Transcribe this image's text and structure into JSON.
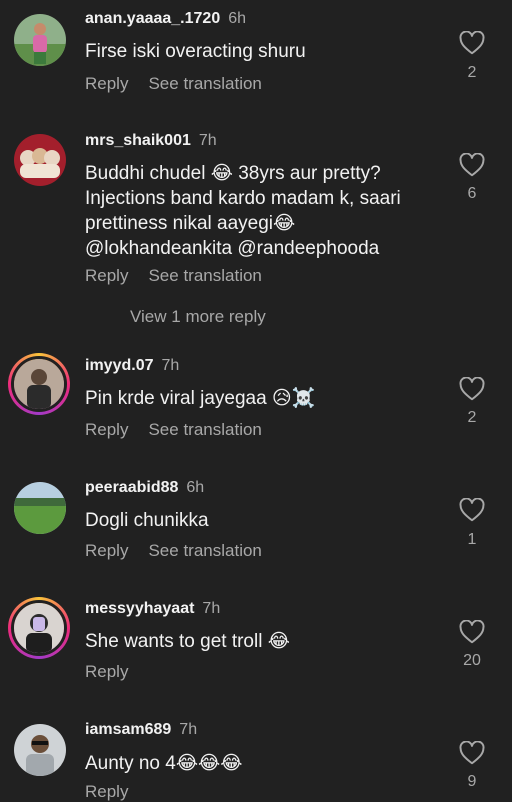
{
  "comments": [
    {
      "username": "anan.yaaaa_.1720",
      "time": "6h",
      "text": "Firse iski overacting shuru",
      "reply_label": "Reply",
      "translation_label": "See translation",
      "likes": "2",
      "avatar_icon": "person-avatar"
    },
    {
      "username": "mrs_shaik001",
      "time": "7h",
      "text": "Buddhi chudel 😂 38yrs aur pretty? Injections band kardo madam k, saari prettiness nikal aayegi😂 @lokhandeankita @randeephooda",
      "reply_label": "Reply",
      "translation_label": "See translation",
      "likes": "6",
      "view_more": "View 1 more reply",
      "avatar_icon": "puppies-avatar"
    },
    {
      "username": "imyyd.07",
      "time": "7h",
      "text": "Pin krde viral jayegaa 😥☠️",
      "reply_label": "Reply",
      "translation_label": "See translation",
      "likes": "2",
      "avatar_icon": "person-avatar"
    },
    {
      "username": "peeraabid88",
      "time": "6h",
      "text": "Dogli chunikka",
      "reply_label": "Reply",
      "translation_label": "See translation",
      "likes": "1",
      "avatar_icon": "landscape-avatar"
    },
    {
      "username": "messyyhayaat",
      "time": "7h",
      "text": "She wants to get troll 😂",
      "reply_label": "Reply",
      "likes": "20",
      "avatar_icon": "person-avatar"
    },
    {
      "username": "iamsam689",
      "time": "7h",
      "text": "Aunty no 4😂😂😂",
      "reply_label": "Reply",
      "likes": "9",
      "avatar_icon": "person-avatar"
    }
  ],
  "colors": {
    "background": "#212121",
    "primary_text": "#f2f2f2",
    "secondary_text": "#a8a8a8",
    "story_ring": "#ee2a7b"
  }
}
